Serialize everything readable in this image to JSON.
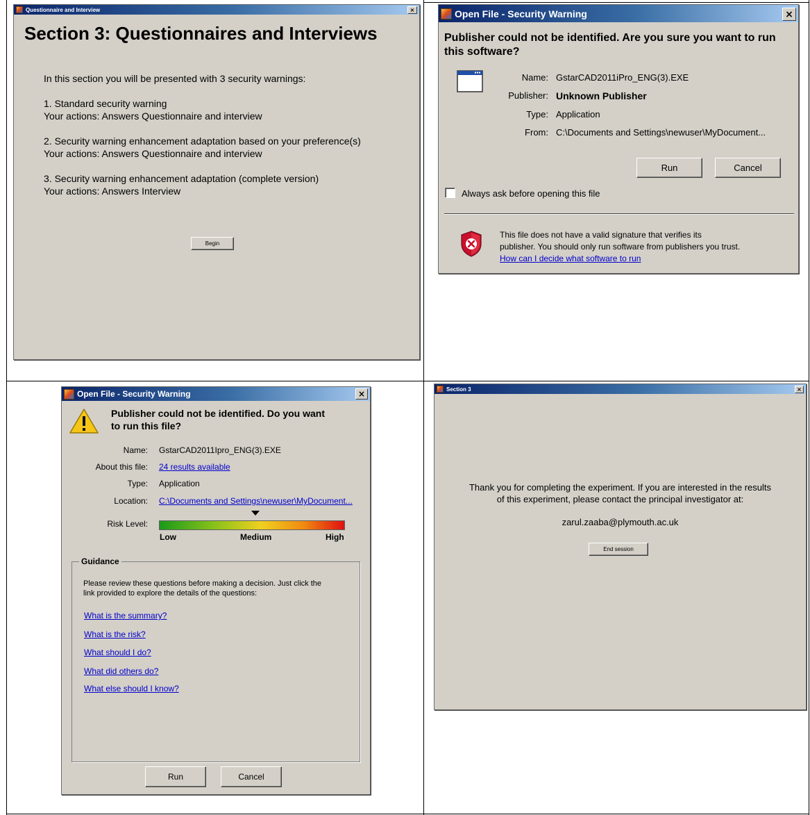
{
  "window_a": {
    "title": "Questionnaire and Interview",
    "heading": "Section 3: Questionnaires and Interviews",
    "intro": "In this section you will be presented with 3 security warnings:",
    "items": [
      {
        "title": "1. Standard security warning",
        "actions": "Your actions: Answers Questionnaire and interview"
      },
      {
        "title": "2. Security warning enhancement adaptation based on your preference(s)",
        "actions": "Your actions: Answers Questionnaire and interview"
      },
      {
        "title": "3. Security warning enhancement adaptation (complete version)",
        "actions": "Your actions: Answers Interview"
      }
    ],
    "begin_label": "Begin",
    "close_label": "×"
  },
  "window_b": {
    "title": "Open File - Security Warning",
    "question": "Publisher could not be identified. Are you sure you want to run this software?",
    "fields": [
      {
        "label": "Name:",
        "value": "GstarCAD2011iPro_ENG(3).EXE"
      },
      {
        "label": "Publisher:",
        "value": "Unknown Publisher"
      },
      {
        "label": "Type:",
        "value": "Application"
      },
      {
        "label": "From:",
        "value": "C:\\Documents and Settings\\newuser\\MyDocument..."
      }
    ],
    "run_label": "Run",
    "cancel_label": "Cancel",
    "checkbox_label": "Always ask before opening this file",
    "checkbox_checked": false,
    "warning_line1": "This file does not have a valid signature that verifies its",
    "warning_line2": "publisher.  You should only run software from publishers you trust.",
    "help_link": "How can I decide what software to run",
    "close_label": "×"
  },
  "window_c": {
    "title": "Open File - Security Warning",
    "question_line1": "Publisher could not be identified. Do you want",
    "question_line2": "to run this file?",
    "fields": [
      {
        "label": "Name:",
        "value": "GstarCAD2011Ipro_ENG(3).EXE",
        "link": false
      },
      {
        "label": "About this file:",
        "value": "24 results available",
        "link": true
      },
      {
        "label": "Type:",
        "value": "Application",
        "link": false
      },
      {
        "label": "Location:",
        "value": "C:\\Documents and Settings\\newuser\\MyDocument...",
        "link": true
      }
    ],
    "risk_label": "Risk Level:",
    "risk_level": 0.52,
    "risk_scale": {
      "low": "Low",
      "medium": "Medium",
      "high": "High"
    },
    "guidance_title": "Guidance",
    "guidance_text_line1": "Please review these questions before making a decision. Just click the",
    "guidance_text_line2": "link provided to explore the details of the questions:",
    "guidance_links": [
      "What is the summary?",
      "What is the risk?",
      "What should I do?",
      "What did others do?",
      "What else should I know?"
    ],
    "run_label": "Run",
    "cancel_label": "Cancel",
    "close_label": "×"
  },
  "window_d": {
    "title": "Section 3",
    "thanks_line1": "Thank you for completing the experiment.  If you are interested in the results",
    "thanks_line2": "of this experiment, please contact the principal investigator at:",
    "email": "zarul.zaaba@plymouth.ac.uk",
    "end_label": "End session",
    "close_label": "×"
  },
  "colors": {
    "window_bg": "#d4d0c8",
    "titlebar_start": "#0a246a",
    "titlebar_end": "#a6caf0",
    "link": "#0000cc",
    "risk_low": "#1a9a1a",
    "risk_high": "#e01010"
  }
}
